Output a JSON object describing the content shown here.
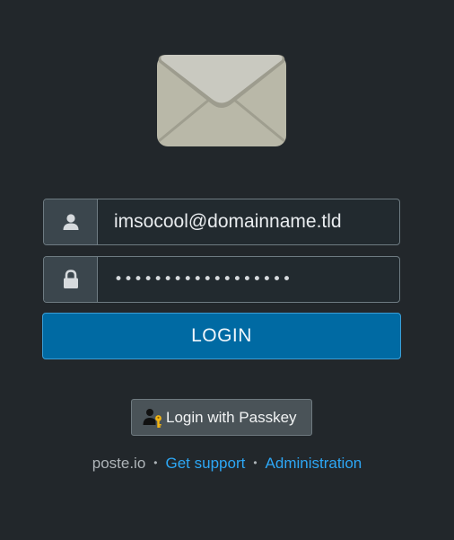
{
  "logo": {
    "icon": "envelope-icon"
  },
  "form": {
    "email": {
      "value": "imsocool@domainname.tld",
      "icon": "user-icon"
    },
    "password": {
      "value": "••••••••••••••••••",
      "icon": "lock-icon"
    },
    "login_label": "LOGIN",
    "passkey_label": "Login with Passkey",
    "passkey_icon": "user-key-icon"
  },
  "footer": {
    "brand": "poste.io",
    "separator": "•",
    "links": [
      {
        "label": "Get support"
      },
      {
        "label": "Administration"
      }
    ]
  },
  "colors": {
    "background": "#22272b",
    "primary": "#006aa3",
    "link": "#2da7f5"
  }
}
